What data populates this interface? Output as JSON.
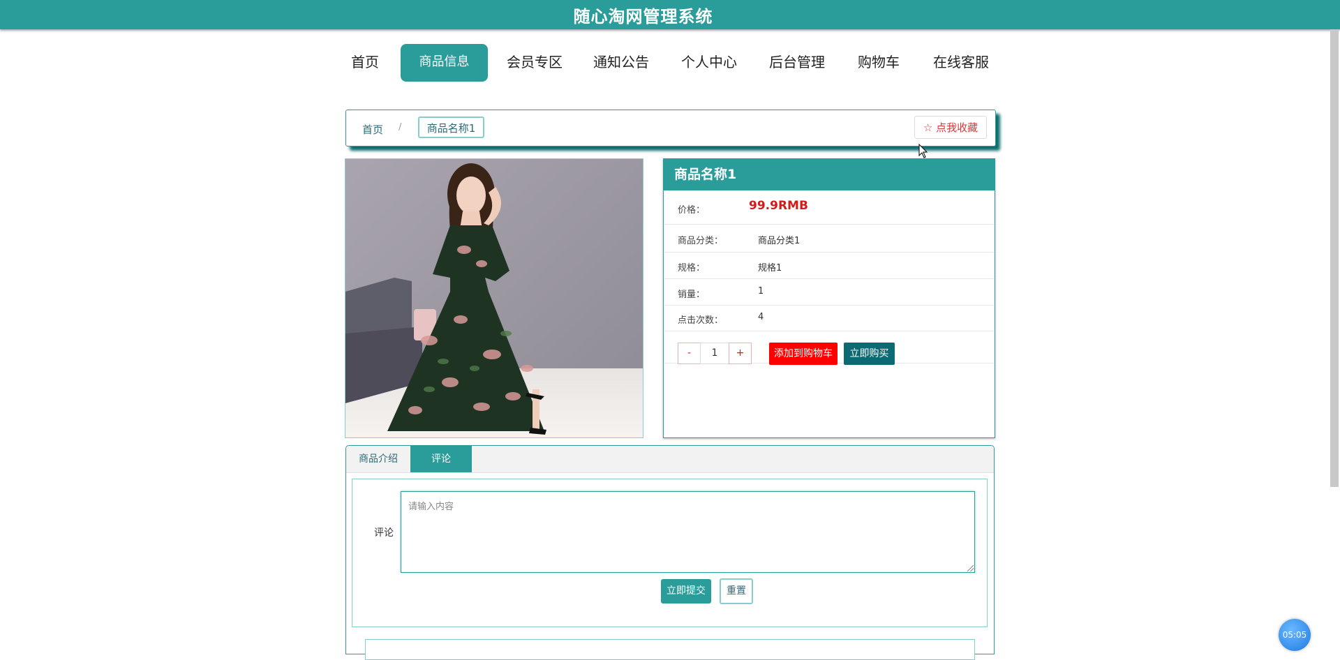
{
  "app": {
    "title": "随心淘网管理系统"
  },
  "nav": {
    "items": [
      {
        "label": "首页"
      },
      {
        "label": "商品信息",
        "active": true
      },
      {
        "label": "会员专区"
      },
      {
        "label": "通知公告"
      },
      {
        "label": "个人中心"
      },
      {
        "label": "后台管理"
      },
      {
        "label": "购物车"
      },
      {
        "label": "在线客服"
      }
    ]
  },
  "breadcrumb": {
    "home": "首页",
    "separator": "/",
    "current": "商品名称1"
  },
  "favorite": {
    "label": "☆ 点我收藏"
  },
  "product": {
    "name": "商品名称1",
    "price_label": "价格：",
    "price": "99.9RMB",
    "details": [
      {
        "label": "商品分类：",
        "value": "商品分类1"
      },
      {
        "label": "规格：",
        "value": "规格1"
      },
      {
        "label": "销量：",
        "value": "1"
      },
      {
        "label": "点击次数：",
        "value": "4"
      }
    ]
  },
  "quantity": {
    "minus": "-",
    "value": "1",
    "plus": "+"
  },
  "actions": {
    "add_to_cart": "添加到购物车",
    "buy_now": "立即购买"
  },
  "tabs": [
    {
      "label": "商品介绍"
    },
    {
      "label": "评论",
      "active": true
    }
  ],
  "review_form": {
    "label": "评论",
    "placeholder": "请输入内容",
    "submit": "立即提交",
    "reset": "重置"
  },
  "timer": {
    "text": "05:05"
  },
  "colors": {
    "primary": "#2a9d9b",
    "price": "#d21c1c",
    "cart_button": "#ff0000",
    "buy_button": "#0b6a72"
  }
}
